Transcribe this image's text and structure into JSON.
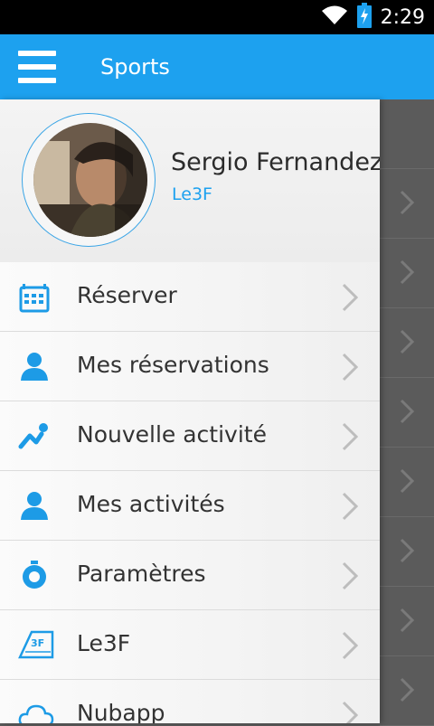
{
  "status_bar": {
    "time": "2:29",
    "icons": [
      "wifi-icon",
      "battery-charging-icon"
    ]
  },
  "app_bar": {
    "title": "Sports",
    "menu_icon": "hamburger-icon"
  },
  "profile": {
    "name": "Sergio Fernandez",
    "club": "Le3F",
    "avatar": "user-avatar-photo"
  },
  "menu": {
    "items": [
      {
        "label": "Réserver",
        "icon": "calendar-icon"
      },
      {
        "label": "Mes réservations",
        "icon": "person-icon"
      },
      {
        "label": "Nouvelle activité",
        "icon": "activity-icon"
      },
      {
        "label": "Mes activités",
        "icon": "person-icon"
      },
      {
        "label": "Paramètres",
        "icon": "settings-icon"
      },
      {
        "label": "Le3F",
        "icon": "le3f-logo-icon",
        "logo_text": "3F"
      },
      {
        "label": "Nubapp",
        "icon": "cloud-icon"
      }
    ]
  },
  "colors": {
    "accent": "#1da1ef",
    "status_bar": "#000000",
    "chevron": "#bdbdbd"
  }
}
